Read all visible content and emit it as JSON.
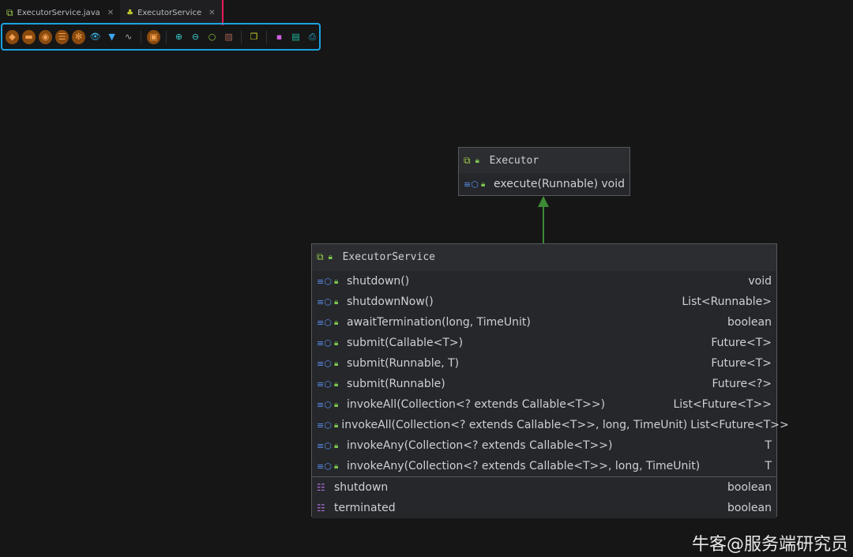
{
  "tabs": [
    {
      "label": "ExecutorService.java",
      "icon": "interface-icon"
    },
    {
      "label": "ExecutorService",
      "icon": "diagram-icon",
      "active": true
    }
  ],
  "toolbar": [
    "fields",
    "constructors",
    "methods",
    "properties",
    "inner-classes",
    "visibility",
    "filter",
    "edge-routing",
    "package",
    "zoom-in",
    "zoom-out",
    "actual-size",
    "fit-content",
    "layout",
    "save",
    "export",
    "print"
  ],
  "executor": {
    "title": "Executor",
    "methods": [
      {
        "name": "execute(Runnable)",
        "type": "void"
      }
    ]
  },
  "service": {
    "title": "ExecutorService",
    "methods": [
      {
        "name": "shutdown()",
        "type": "void"
      },
      {
        "name": "shutdownNow()",
        "type": "List<Runnable>"
      },
      {
        "name": "awaitTermination(long, TimeUnit)",
        "type": "boolean"
      },
      {
        "name": "submit(Callable<T>)",
        "type": "Future<T>"
      },
      {
        "name": "submit(Runnable, T)",
        "type": "Future<T>"
      },
      {
        "name": "submit(Runnable)",
        "type": "Future<?>"
      },
      {
        "name": "invokeAll(Collection<? extends Callable<T>>)",
        "type": "List<Future<T>>"
      },
      {
        "name": "invokeAll(Collection<? extends Callable<T>>, long, TimeUnit)",
        "type": "List<Future<T>>"
      },
      {
        "name": "invokeAny(Collection<? extends Callable<T>>)",
        "type": "T"
      },
      {
        "name": "invokeAny(Collection<? extends Callable<T>>, long, TimeUnit)",
        "type": "T"
      }
    ],
    "fields": [
      {
        "name": "shutdown",
        "type": "boolean"
      },
      {
        "name": "terminated",
        "type": "boolean"
      }
    ]
  },
  "watermark": "牛客@服务端研究员",
  "colors": {
    "accent": "#1aa3e0",
    "edge": "#3d8a34"
  }
}
